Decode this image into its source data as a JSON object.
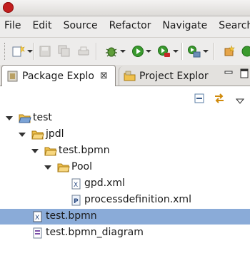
{
  "menu": [
    "File",
    "Edit",
    "Source",
    "Refactor",
    "Navigate",
    "Search"
  ],
  "tabs": {
    "active": {
      "label": "Package Explo",
      "close": "⊠"
    },
    "inactive": {
      "label": "Project Explor"
    }
  },
  "view_buttons": {
    "minimize": "▭",
    "maximize": "▢"
  },
  "tree": [
    {
      "label": "test",
      "depth": 0,
      "icon": "project-folder-icon",
      "expanded": true
    },
    {
      "label": "jpdl",
      "depth": 1,
      "icon": "folder-icon",
      "expanded": true
    },
    {
      "label": "test.bpmn",
      "depth": 2,
      "icon": "folder-icon",
      "expanded": true
    },
    {
      "label": "Pool",
      "depth": 3,
      "icon": "folder-icon",
      "expanded": true
    },
    {
      "label": "gpd.xml",
      "depth": 4,
      "icon": "xml-file-icon"
    },
    {
      "label": "processdefinition.xml",
      "depth": 4,
      "icon": "process-file-icon"
    },
    {
      "label": "test.bpmn",
      "depth": 1,
      "icon": "xml-file-icon",
      "selected": true
    },
    {
      "label": "test.bpmn_diagram",
      "depth": 1,
      "icon": "diagram-file-icon"
    }
  ],
  "colors": {
    "selection": "#8aabd8",
    "folder": "#e9b23c"
  }
}
